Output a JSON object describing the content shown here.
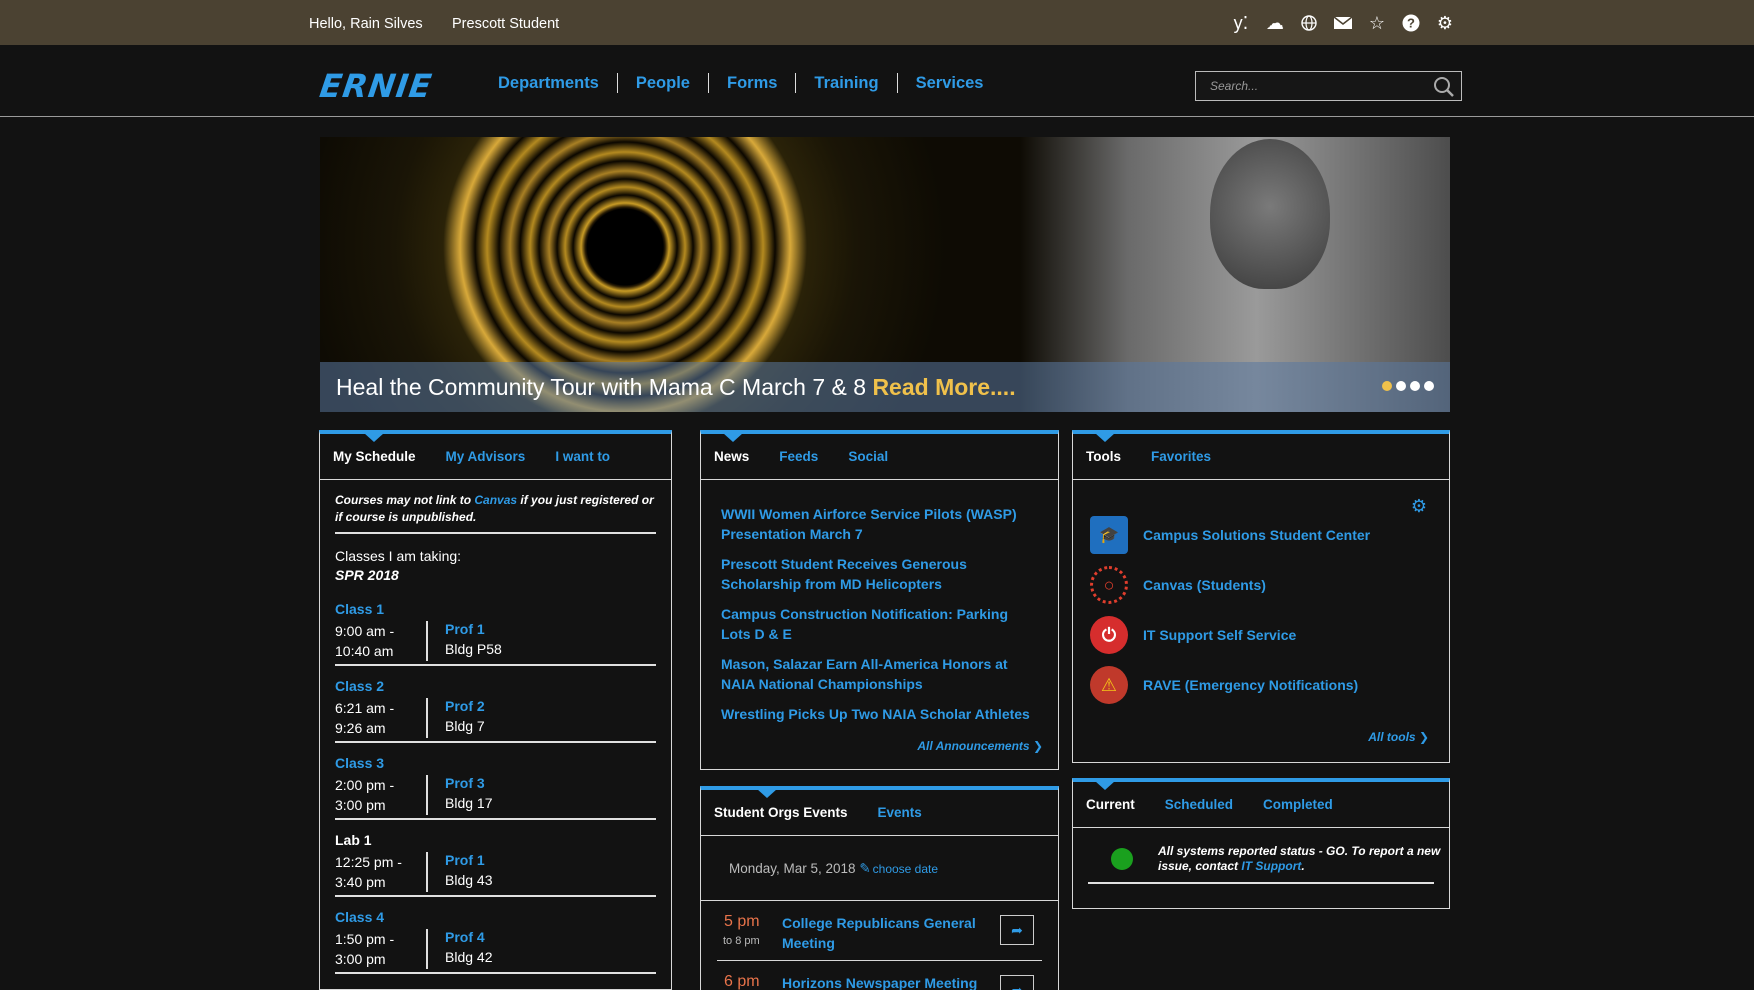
{
  "userbar": {
    "greeting": "Hello, Rain Silves",
    "org": "Prescott Student",
    "icons": [
      "yammer-icon",
      "cloud-icon",
      "globe-icon",
      "mail-icon",
      "star-icon",
      "help-icon",
      "gear-icon"
    ]
  },
  "nav": {
    "logo": "ERNIE",
    "links": [
      "Departments",
      "People",
      "Forms",
      "Training",
      "Services"
    ],
    "search_placeholder": "Search..."
  },
  "hero": {
    "caption": "Heal the Community Tour with Mama C March 7 & 8 ",
    "read_more": "Read More....",
    "slides_total": 4,
    "slide_active": 1
  },
  "schedule": {
    "tabs": [
      "My Schedule",
      "My Advisors",
      "I want to"
    ],
    "note_prefix": "Courses may not link to ",
    "note_link": "Canvas",
    "note_suffix": " if you just registered or if course is unpublished.",
    "taking_label": "Classes I am taking:",
    "term": "SPR 2018",
    "classes": [
      {
        "name": "Class 1",
        "start": "9:00 am -",
        "end": "10:40 am",
        "prof": "Prof 1",
        "bldg": "Bldg P58"
      },
      {
        "name": "Class 2",
        "start": "6:21 am -",
        "end": "9:26 am",
        "prof": "Prof 2",
        "bldg": "Bldg 7"
      },
      {
        "name": "Class 3",
        "start": "2:00 pm -",
        "end": "3:00 pm",
        "prof": "Prof 3",
        "bldg": "Bldg 17"
      },
      {
        "name": "Lab 1",
        "start": "12:25 pm -",
        "end": "3:40 pm",
        "prof": "Prof 1",
        "bldg": "Bldg 43"
      },
      {
        "name": "Class 4",
        "start": "1:50 pm -",
        "end": "3:00 pm",
        "prof": "Prof 4",
        "bldg": "Bldg 42"
      }
    ]
  },
  "news": {
    "tabs": [
      "News",
      "Feeds",
      "Social"
    ],
    "items": [
      "WWII Women Airforce Service Pilots (WASP) Presentation March 7",
      "Prescott Student Receives Generous Scholarship from MD Helicopters",
      "Campus Construction Notification: Parking Lots D & E",
      "Mason, Salazar Earn All-America Honors at NAIA National Championships",
      "Wrestling Picks Up Two NAIA Scholar Athletes"
    ],
    "all_label": "All Announcements"
  },
  "events": {
    "tabs": [
      "Student Orgs Events",
      "Events"
    ],
    "date": "Monday, Mar 5, 2018",
    "choose_date": "choose date",
    "items": [
      {
        "time": "5 pm",
        "to": "to 8 pm",
        "title": "College Republicans General Meeting"
      },
      {
        "time": "6 pm",
        "to": "",
        "title": "Horizons Newspaper Meeting"
      }
    ]
  },
  "tools": {
    "tabs": [
      "Tools",
      "Favorites"
    ],
    "items": [
      {
        "label": "Campus Solutions Student Center",
        "icon": "graduation-folder-icon",
        "color": "#1f6fbf"
      },
      {
        "label": "Canvas (Students)",
        "icon": "canvas-icon",
        "color": "#e03e2d"
      },
      {
        "label": "IT Support Self Service",
        "icon": "power-icon",
        "color": "#d62d2d"
      },
      {
        "label": "RAVE (Emergency Notifications)",
        "icon": "warning-icon",
        "color": "#c0392b"
      }
    ],
    "all_label": "All tools"
  },
  "status": {
    "tabs": [
      "Current",
      "Scheduled",
      "Completed"
    ],
    "message": "All systems reported status - GO. To report a new issue, contact ",
    "link": "IT Support",
    "suffix": ".",
    "color": "#1aa01e"
  }
}
